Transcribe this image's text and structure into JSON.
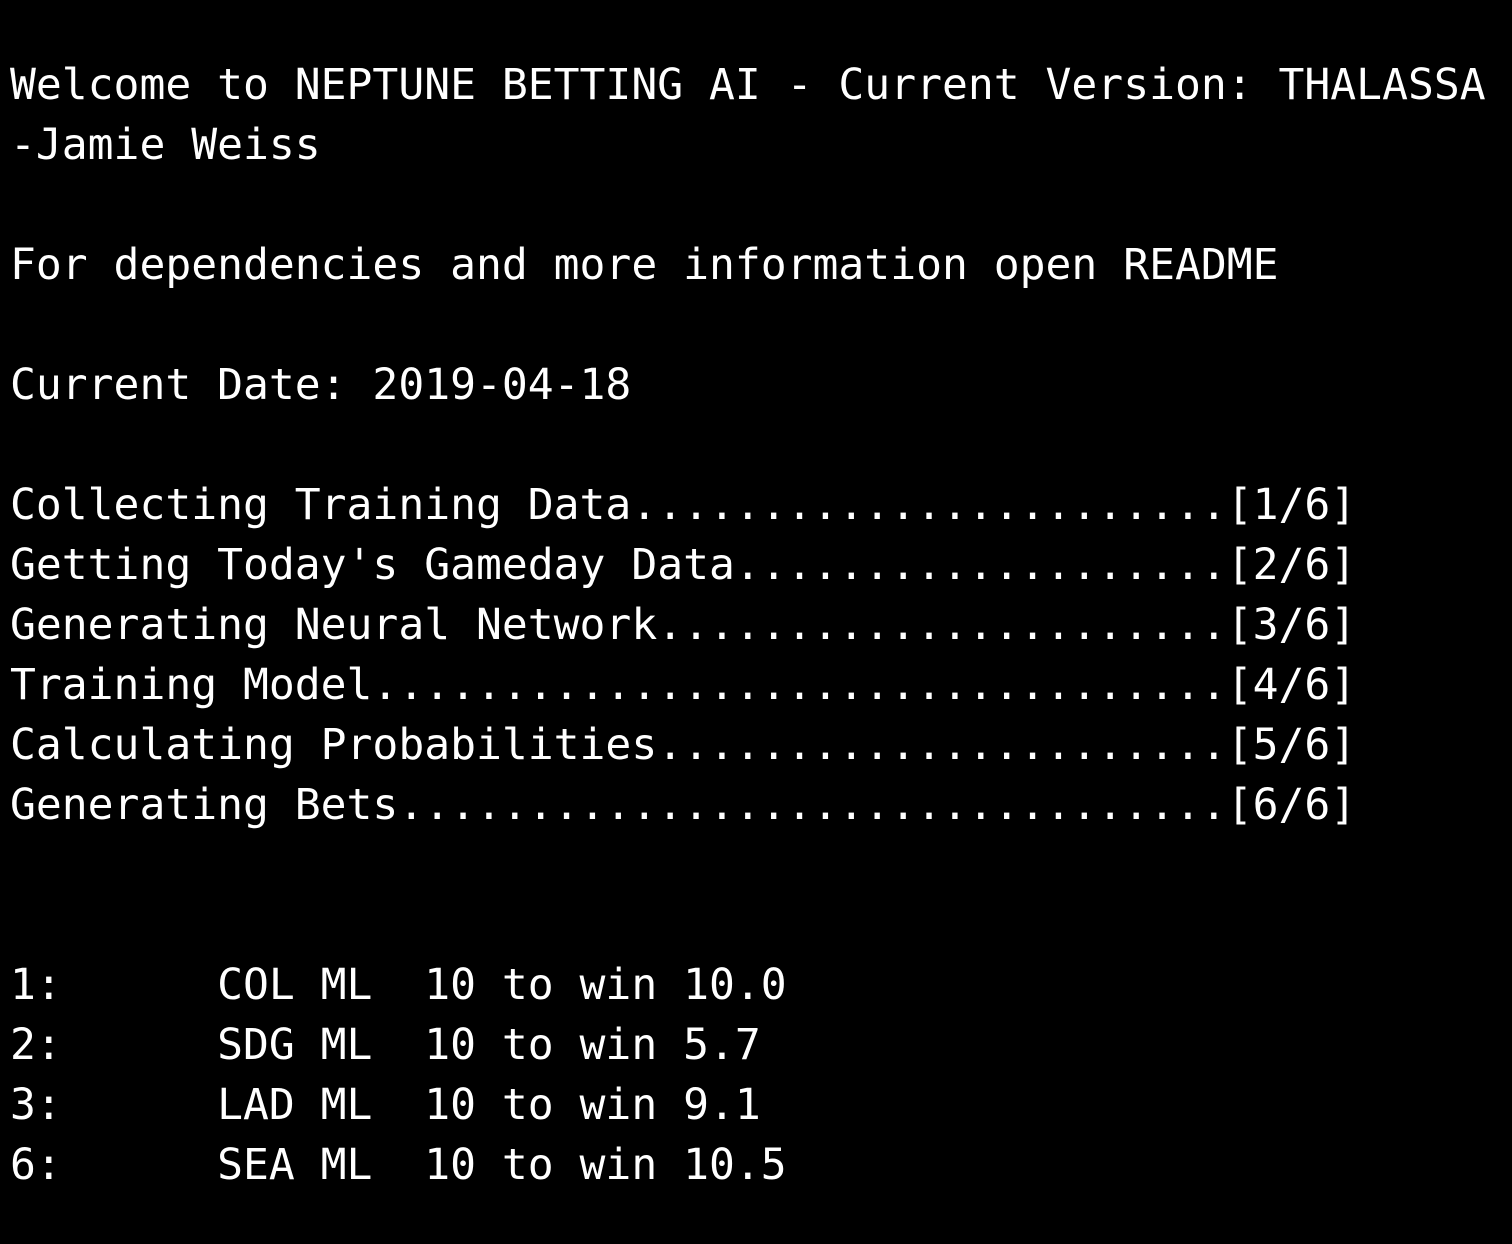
{
  "terminal": {
    "welcome_line": "Welcome to NEPTUNE BETTING AI - Current Version: THALASSA",
    "author_line": "-Jamie Weiss",
    "readme_line": "For dependencies and more information open README",
    "date_line": "Current Date: 2019-04-18",
    "progress": [
      "Collecting Training Data.......................[1/6]",
      "Getting Today's Gameday Data...................[2/6]",
      "Generating Neural Network......................[3/6]",
      "Training Model.................................[4/6]",
      "Calculating Probabilities......................[5/6]",
      "Generating Bets................................[6/6]"
    ],
    "bets": [
      "1:      COL ML  10 to win 10.0",
      "2:      SDG ML  10 to win 5.7",
      "3:      LAD ML  10 to win 9.1",
      "6:      SEA ML  10 to win 10.5"
    ]
  }
}
